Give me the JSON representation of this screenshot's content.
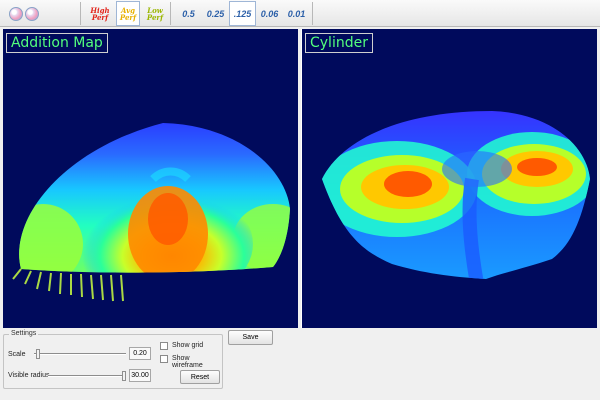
{
  "toolbar": {
    "logo_icon": "two-spheres-logo-icon",
    "perf_buttons": [
      {
        "line1": "High",
        "line2": "Perf",
        "color": "#e2231a",
        "selected": false
      },
      {
        "line1": "Avg",
        "line2": "Perf",
        "color": "#e8b000",
        "selected": true
      },
      {
        "line1": "Low",
        "line2": "Perf",
        "color": "#9bb600",
        "selected": false
      }
    ],
    "zoom_levels": [
      {
        "label": "0.5",
        "selected": false
      },
      {
        "label": "0.25",
        "selected": false
      },
      {
        "label": ".125",
        "selected": true
      },
      {
        "label": "0.06",
        "selected": false
      },
      {
        "label": "0.01",
        "selected": false
      }
    ]
  },
  "panels": {
    "left": {
      "title": "Addition Map",
      "map_type": "power-map-color-surface"
    },
    "right": {
      "title": "Cylinder",
      "map_type": "power-map-color-surface"
    },
    "background_color": "#000a5c",
    "title_color": "#53ff7d"
  },
  "settings": {
    "legend": "Settings",
    "scale": {
      "label": "Scale",
      "value": "0.20",
      "fraction": 0.02
    },
    "visible_radius": {
      "label": "Visible radius",
      "value": "30.00",
      "fraction": 1.0
    },
    "show_grid": {
      "label": "Show grid",
      "checked": false
    },
    "show_wireframe": {
      "label": "Show wireframe",
      "checked": false
    },
    "reset_label": "Reset"
  },
  "save_label": "Save"
}
